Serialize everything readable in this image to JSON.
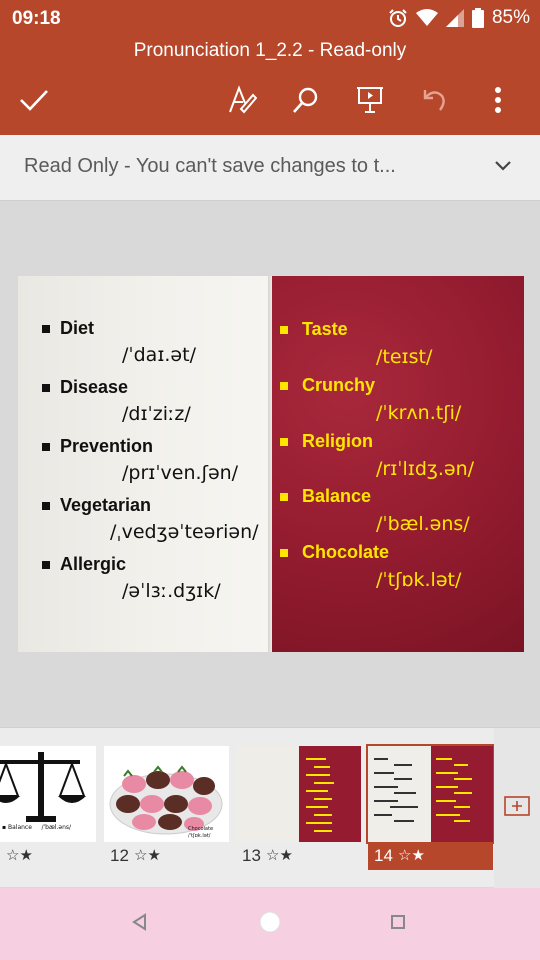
{
  "status": {
    "time": "09:18",
    "battery": "85%"
  },
  "title": "Pronunciation 1_2.2 - Read-only",
  "toolbar": {
    "icons": [
      "check-icon",
      "draw-pen-icon",
      "search-icon",
      "present-icon",
      "undo-icon",
      "more-icon"
    ]
  },
  "banner": {
    "text": "Read Only - You can't save changes to t..."
  },
  "slide": {
    "left_items": [
      {
        "word": "Diet",
        "ipa": "/ˈdaɪ.ət/"
      },
      {
        "word": "Disease",
        "ipa": "/dɪˈziːz/"
      },
      {
        "word": "Prevention",
        "ipa": "/prɪˈven.ʃən/"
      },
      {
        "word": "Vegetarian",
        "ipa": "/ˌvedʒəˈteəriən/"
      },
      {
        "word": "Allergic",
        "ipa": "/əˈlɜː.dʒɪk/"
      }
    ],
    "right_items": [
      {
        "word": "Taste",
        "ipa": "/teɪst/"
      },
      {
        "word": "Crunchy",
        "ipa": "/ˈkrʌn.tʃi/"
      },
      {
        "word": "Religion",
        "ipa": "/rɪˈlɪdʒ.ən/"
      },
      {
        "word": "Balance",
        "ipa": "/ˈbæl.əns/"
      },
      {
        "word": "Chocolate",
        "ipa": "/ˈtʃɒk.lət/"
      }
    ]
  },
  "thumbnails": [
    {
      "number": "",
      "star": "☆★"
    },
    {
      "number": "12",
      "star": "☆★"
    },
    {
      "number": "13",
      "star": "☆★"
    },
    {
      "number": "14",
      "star": "☆★",
      "selected": true
    }
  ],
  "thumb_texts": {
    "t11_balance": "Balance",
    "t11_ipa": "/ˈbæl.əns/",
    "t12_caption": "Chocolate",
    "t12_ipa": "/ˈtʃɒk.lət/"
  },
  "colors": {
    "accent": "#b7472a",
    "slide_red": "#951c30",
    "yellow": "#ffe600"
  }
}
